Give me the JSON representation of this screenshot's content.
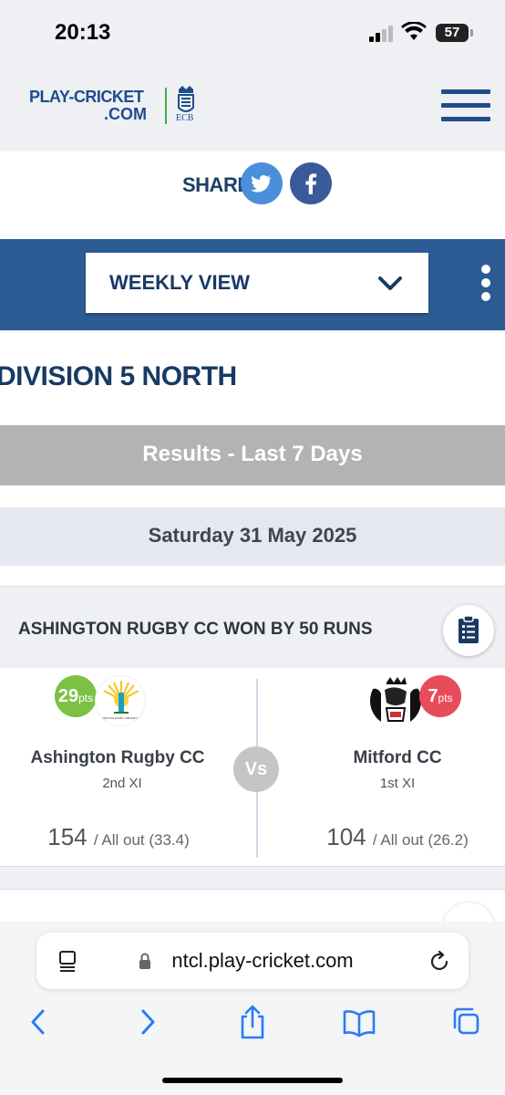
{
  "status": {
    "time": "20:13",
    "battery": "57"
  },
  "header": {
    "logo_line1": "PLAY-CRICKET",
    "logo_line2": ".COM",
    "ecb_label": "ECB"
  },
  "share": {
    "label": "SHARE"
  },
  "view_selector": {
    "selected": "WEEKLY VIEW"
  },
  "division": {
    "title": "DIVISION 5 NORTH"
  },
  "results_header": "Results - Last 7 Days",
  "date": "Saturday 31 May 2025",
  "match": {
    "result": "ASHINGTON RUGBY CC WON BY 50 RUNS",
    "vs": "Vs",
    "home": {
      "name": "Ashington Rugby CC",
      "team": "2nd XI",
      "points": "29",
      "points_unit": "pts",
      "runs": "154",
      "detail": "/ All out (33.4)"
    },
    "away": {
      "name": "Mitford CC",
      "team": "1st XI",
      "points": "7",
      "points_unit": "pts",
      "runs": "104",
      "detail": "/ All out (26.2)"
    }
  },
  "browser": {
    "url": "ntcl.play-cricket.com"
  },
  "colors": {
    "brand_blue": "#2c5b94",
    "navy": "#183a64",
    "green": "#7cc142",
    "red": "#e84c5a"
  }
}
